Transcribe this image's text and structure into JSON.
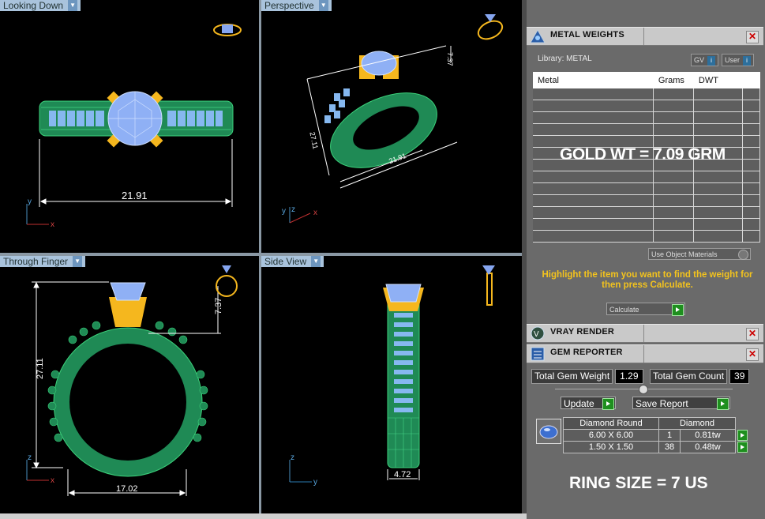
{
  "viewports": {
    "top_left": {
      "label": "Looking Down",
      "dimension": "21.91",
      "axis_v": "y",
      "axis_h": "x"
    },
    "top_right": {
      "label": "Perspective",
      "dim_height": "7.37",
      "dim_side": "27.11",
      "dim_bottom": "21.91",
      "axis_v": "z",
      "axis_h": "x"
    },
    "bottom_left": {
      "label": "Through Finger",
      "dim_height": "27.11",
      "dim_crown": "7.37",
      "dim_width": "17.02",
      "axis_v": "z",
      "axis_h": "x"
    },
    "bottom_right": {
      "label": "Side View",
      "dim_width": "4.72",
      "axis_v": "z",
      "axis_h": "y"
    }
  },
  "metal_weights": {
    "title": "METAL WEIGHTS",
    "library_label": "Library: METAL",
    "gv_label": "GV",
    "user_label": "User",
    "columns": [
      "Metal",
      "Grams",
      "DWT"
    ],
    "overlay": "GOLD WT = 7.09 GRM",
    "use_object_materials": "Use Object Materials",
    "hint": "Highlight the item you want to find the weight for then press Calculate.",
    "calculate_label": "Calculate"
  },
  "vray": {
    "title": "VRAY RENDER"
  },
  "gem_reporter": {
    "title": "GEM REPORTER",
    "total_weight_label": "Total Gem Weight",
    "total_weight_value": "1.29",
    "total_count_label": "Total Gem Count",
    "total_count_value": "39",
    "update_label": "Update",
    "save_label": "Save Report",
    "table_headers": [
      "Diamond Round",
      "Diamond"
    ],
    "rows": [
      {
        "size": "6.00 X 6.00",
        "count": "1",
        "weight": "0.81tw"
      },
      {
        "size": "1.50 X 1.50",
        "count": "38",
        "weight": "0.48tw"
      }
    ],
    "ring_size": "RING SIZE = 7 US"
  },
  "colors": {
    "band": "#1f8a55",
    "gold": "#f5b71e",
    "diamond": "#86a6f0",
    "dimension": "#ffffff",
    "hint": "#f3c31d"
  }
}
